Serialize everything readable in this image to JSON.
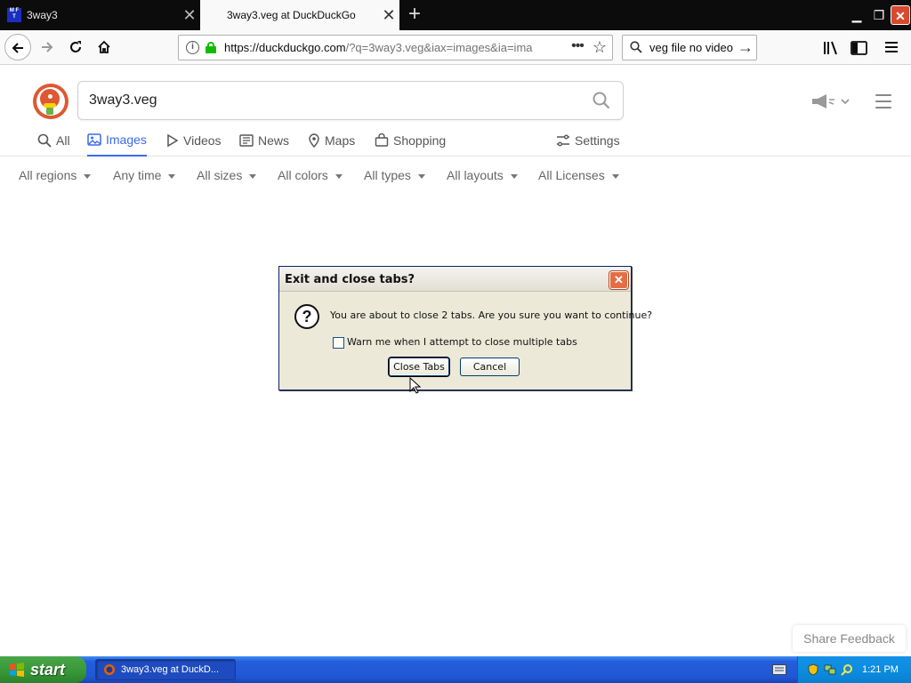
{
  "browser": {
    "tabs": [
      {
        "title": "3way3",
        "favicon_text": "MFT",
        "active": false
      },
      {
        "title": "3way3.veg at DuckDuckGo",
        "active": true
      }
    ],
    "url_display_host": "https://duckduckgo.com",
    "url_display_rest": "/?q=3way3.veg&iax=images&ia=ima",
    "search_bar_text": "veg file no video",
    "icons": {
      "back": "back-arrow-icon",
      "forward": "forward-arrow-icon",
      "reload": "reload-icon",
      "home": "home-icon",
      "info": "info-icon",
      "lock": "lock-icon",
      "more": "page-actions-icon",
      "bookmark": "star-icon",
      "library": "library-icon",
      "sidebar": "sidebar-icon",
      "menu": "hamburger-menu-icon"
    }
  },
  "page": {
    "search_query": "3way3.veg",
    "nav_tabs": [
      {
        "label": "All",
        "active": false
      },
      {
        "label": "Images",
        "active": true
      },
      {
        "label": "Videos",
        "active": false
      },
      {
        "label": "News",
        "active": false
      },
      {
        "label": "Maps",
        "active": false
      },
      {
        "label": "Shopping",
        "active": false
      }
    ],
    "settings_label": "Settings",
    "filters": [
      "All regions",
      "Any time",
      "All sizes",
      "All colors",
      "All types",
      "All layouts",
      "All Licenses"
    ],
    "share_feedback": "Share Feedback",
    "accent_color": "#3969ef"
  },
  "dialog": {
    "title": "Exit and close tabs?",
    "message": "You are about to close 2 tabs. Are you sure you want to continue?",
    "checkbox_label": "Warn me when I attempt to close multiple tabs",
    "checkbox_checked": false,
    "confirm_label": "Close Tabs",
    "cancel_label": "Cancel"
  },
  "taskbar": {
    "start_label": "start",
    "task_item": "3way3.veg at DuckD...",
    "clock": "1:21 PM"
  }
}
